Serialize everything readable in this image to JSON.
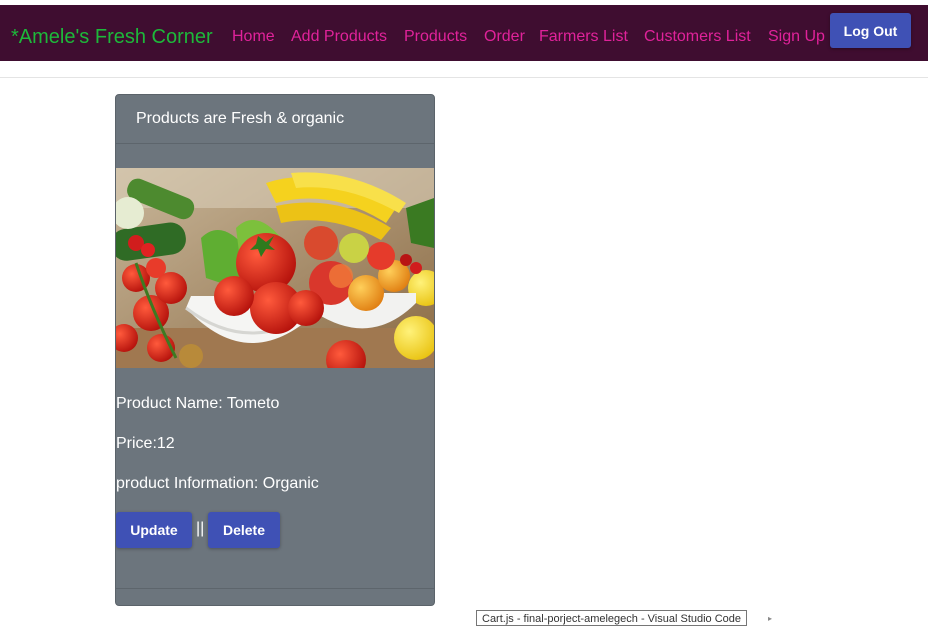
{
  "navbar": {
    "brand": "*Amele's Fresh Corner",
    "links": [
      "Home",
      "Add Products",
      "Products",
      "Order",
      "Farmers List",
      "Customers List",
      "Sign Up"
    ],
    "logout_label": "Log Out"
  },
  "card": {
    "header": "Products are Fresh & organic",
    "product_name": "Product Name: Tometo",
    "price": "Price:12",
    "information": "product Information: Organic",
    "update_label": "Update",
    "separator": "||",
    "delete_label": "Delete"
  },
  "taskbar_tooltip": "Cart.js - final-porject-amelegech - Visual Studio Code",
  "colors": {
    "navbar_bg": "#3f0d30",
    "brand": "#1db83a",
    "nav_link": "#e0229a",
    "button": "#3f51b5",
    "card_bg": "#6c757d"
  }
}
